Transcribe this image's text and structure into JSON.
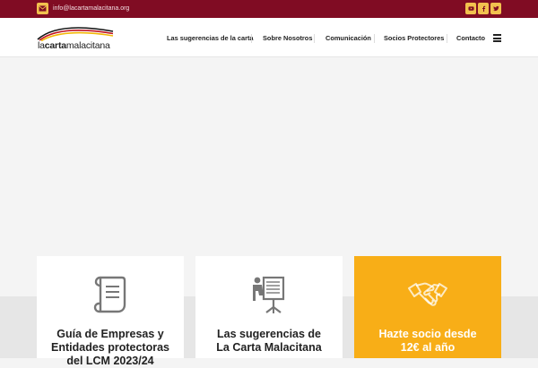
{
  "topbar": {
    "email": "info@lacartamalacitana.org",
    "icons": {
      "mail": "envelope-icon",
      "youtube": "youtube-icon",
      "facebook": "facebook-icon",
      "twitter": "twitter-icon"
    },
    "colors": {
      "background": "#800c23",
      "accent": "#f2c14e"
    }
  },
  "logo": {
    "prefix": "la",
    "bold": "carta",
    "suffix": "malacitana"
  },
  "nav": {
    "items": [
      {
        "label": "Las sugerencias de la carta"
      },
      {
        "label": "Sobre Nosotros"
      },
      {
        "label": "Comunicación"
      },
      {
        "label": "Socios Protectores"
      },
      {
        "label": "Contacto"
      }
    ],
    "menu_icon": "hamburger-menu-icon"
  },
  "cards": [
    {
      "title_lines": [
        "Guía de Empresas y",
        "Entidades protectoras",
        "del LCM 2023/24"
      ],
      "icon": "document-scroll-icon"
    },
    {
      "title_lines": [
        "Las sugerencias de",
        "La Carta Malacitana"
      ],
      "icon": "presentation-board-icon"
    },
    {
      "title_lines": [
        "Hazte socio desde",
        "12€ al año"
      ],
      "icon": "handshake-icon",
      "color": "#f8ae17"
    }
  ]
}
